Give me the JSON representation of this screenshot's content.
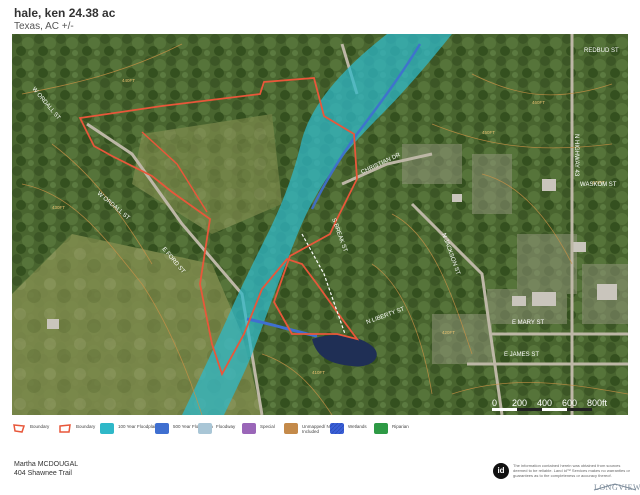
{
  "header": {
    "title": "hale, ken 24.38 ac",
    "subtitle": "Texas, AC +/-"
  },
  "streets": {
    "redbud": "REDBUD ST",
    "waskom": "WASKOM ST",
    "emary": "E MARY ST",
    "ejames": "E JAMES ST",
    "christian": "CHRISTIAN DR",
    "jackson": "N JACKSON ST",
    "liberty": "N LIBERTY ST",
    "ordall": "W ORDALL ST",
    "ordall2": "W ORDALL ST",
    "eford": "E FORD ST",
    "highway": "N HIGHWAY 43",
    "sbreak": "S BREAK ST"
  },
  "contours": {
    "c410": "410FT",
    "c420": "420FT",
    "c430": "430FT",
    "c440": "440FT",
    "c450": "450FT",
    "c460": "460FT",
    "c470": "470FT"
  },
  "scale": {
    "labels": [
      "0",
      "200",
      "400",
      "600",
      "800ft"
    ]
  },
  "legend": [
    {
      "label": "Boundary",
      "color": "#e8573a",
      "kind": "outline"
    },
    {
      "label": "Boundary",
      "color": "#e8573a",
      "kind": "outline2"
    },
    {
      "label": "100 Year Floodplain",
      "color": "#2fb8c8",
      "kind": "fill"
    },
    {
      "label": "500 Year Floodplain",
      "color": "#3f6fd0",
      "kind": "fill"
    },
    {
      "label": "Floodway",
      "color": "#a9c6d6",
      "kind": "fill"
    },
    {
      "label": "Special",
      "color": "#9a66b8",
      "kind": "fill"
    },
    {
      "label": "Unmapped/ Not Included",
      "color": "#c48a4a",
      "kind": "fill"
    },
    {
      "label": "Wetlands",
      "color": "#3a5fd8",
      "kind": "hatch"
    },
    {
      "label": "Riparian",
      "color": "#2e9a45",
      "kind": "hatch"
    }
  ],
  "footer": {
    "name": "Martha MCDOUGAL",
    "address": "404 Shawnee Trail",
    "logo": "id",
    "disclaimer": "The information contained herein was obtained from sources deemed to be reliable. Land id™ Services makes no warranties or guarantees as to the completeness or accuracy thereof.",
    "watermark": "LONGVIEW"
  }
}
